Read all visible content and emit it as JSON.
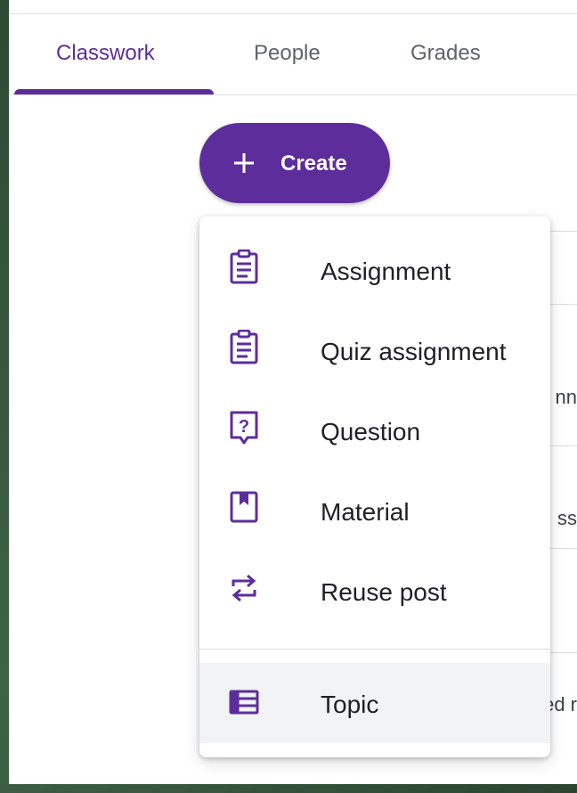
{
  "tabs": [
    {
      "label": "Classwork",
      "active": true
    },
    {
      "label": "People",
      "active": false
    },
    {
      "label": "Grades",
      "active": false
    }
  ],
  "create_button": {
    "label": "Create",
    "icon": "plus-icon"
  },
  "background_list": {
    "fragments": [
      "nn",
      "ss",
      "ed r"
    ]
  },
  "menu": {
    "items": [
      {
        "label": "Assignment",
        "icon": "assignment-icon"
      },
      {
        "label": "Quiz assignment",
        "icon": "quiz-assignment-icon"
      },
      {
        "label": "Question",
        "icon": "question-icon"
      },
      {
        "label": "Material",
        "icon": "material-icon"
      },
      {
        "label": "Reuse post",
        "icon": "reuse-icon"
      },
      {
        "label": "Topic",
        "icon": "topic-icon",
        "highlighted": true
      }
    ]
  },
  "colors": {
    "accent": "#5d2e9b",
    "highlight": "#f1f3f4"
  }
}
